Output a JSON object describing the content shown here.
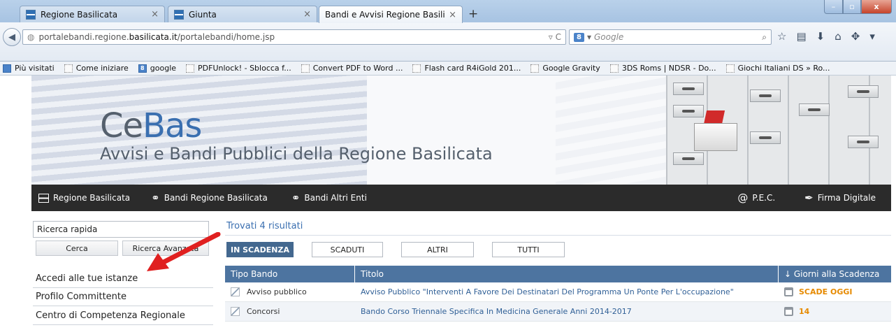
{
  "browser": {
    "tabs": [
      {
        "title": "Regione Basilicata"
      },
      {
        "title": "Giunta"
      },
      {
        "title": "Bandi e Avvisi Regione Basilicata"
      }
    ],
    "new_tab": "+",
    "url_prefix": "portalebandi.regione.",
    "url_host": "basilicata.it",
    "url_path": "/portalebandi/home.jsp",
    "search_placeholder": "Google",
    "bookmarks": [
      {
        "label": "Più visitati"
      },
      {
        "label": "Come iniziare"
      },
      {
        "label": "google"
      },
      {
        "label": "PDFUnlock! - Sblocca f..."
      },
      {
        "label": "Convert PDF to Word ..."
      },
      {
        "label": "Flash card R4iGold 201..."
      },
      {
        "label": "Google Gravity"
      },
      {
        "label": "3DS Roms | NDSR - Do..."
      },
      {
        "label": "Giochi Italiani DS » Ro..."
      }
    ]
  },
  "banner": {
    "logo_part1": "Ce",
    "logo_part2": "Bas",
    "subtitle": "Avvisi e Bandi Pubblici della Regione Basilicata"
  },
  "menu": {
    "items": [
      {
        "label": "Regione Basilicata"
      },
      {
        "label": "Bandi Regione Basilicata"
      },
      {
        "label": "Bandi Altri Enti"
      }
    ],
    "right_items": [
      {
        "label": "P.E.C."
      },
      {
        "label": "Firma Digitale"
      }
    ]
  },
  "sidebar": {
    "search_value": "Ricerca rapida",
    "search_button": "Cerca",
    "advanced_button": "Ricerca Avanzata",
    "links": [
      {
        "label": "Accedi alle tue istanze"
      },
      {
        "label": "Profilo Committente"
      },
      {
        "label": "Centro di Competenza Regionale"
      }
    ]
  },
  "results": {
    "count_text": "Trovati 4 risultati",
    "filters": [
      {
        "label": "IN SCADENZA",
        "active": true
      },
      {
        "label": "SCADUTI",
        "active": false
      },
      {
        "label": "ALTRI",
        "active": false
      },
      {
        "label": "TUTTI",
        "active": false
      }
    ],
    "columns": [
      "Tipo Bando",
      "Titolo",
      "↓ Giorni alla Scadenza"
    ],
    "rows": [
      {
        "tipo": "Avviso pubblico",
        "titolo": "Avviso Pubblico \"Interventi A Favore Dei Destinatari Del Programma Un Ponte Per L'occupazione\"",
        "giorni": "SCADE OGGI"
      },
      {
        "tipo": "Concorsi",
        "titolo": "Bando Corso Triennale Specifica In Medicina Generale Anni 2014-2017",
        "giorni": "14"
      }
    ]
  },
  "colors": {
    "menu_bg": "#2b2b2b",
    "table_header": "#4d74a0",
    "filter_active": "#43688f",
    "link": "#2f5f96",
    "deadline": "#e68a00",
    "arrow": "#e02020"
  }
}
